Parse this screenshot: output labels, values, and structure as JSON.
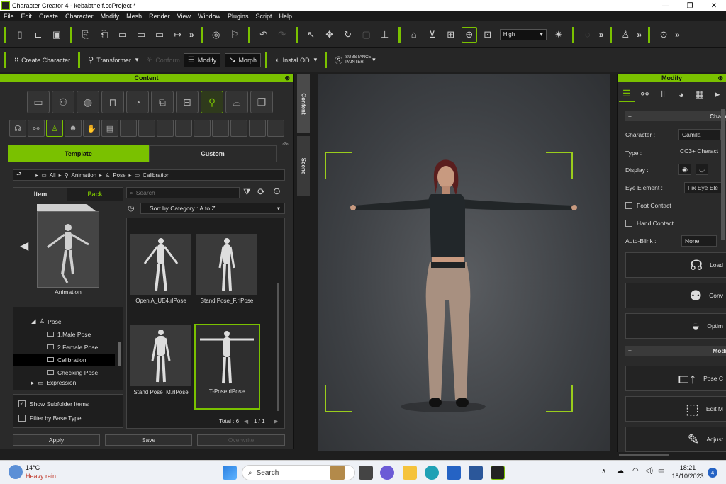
{
  "window": {
    "title": "Character Creator 4 - kebabtheif.ccProject *",
    "min": "—",
    "max": "❐",
    "close": "✕"
  },
  "menu": [
    "File",
    "Edit",
    "Create",
    "Character",
    "Modify",
    "Mesh",
    "Render",
    "View",
    "Window",
    "Plugins",
    "Script",
    "Help"
  ],
  "toolbar1": {
    "quality_value": "High"
  },
  "toolbar2": {
    "create_character": "Create Character",
    "transformer": "Transformer",
    "conform": "Conform",
    "modify": "Modify",
    "morph": "Morph",
    "instalod": "InstaLOD",
    "substance": "SUBSTANCE PAINTER"
  },
  "content_panel": {
    "title": "Content",
    "tab_template": "Template",
    "tab_custom": "Custom",
    "breadcrumb": [
      "All",
      "Animation",
      "Pose",
      "Calibration"
    ],
    "subtab_item": "Item",
    "subtab_pack": "Pack",
    "pack_label": "Animation",
    "tree": [
      {
        "label": "Pose",
        "selected": false
      },
      {
        "label": "1.Male Pose",
        "selected": false
      },
      {
        "label": "2.Female Pose",
        "selected": false
      },
      {
        "label": "Calibration",
        "selected": true
      },
      {
        "label": "Checking Pose",
        "selected": false
      },
      {
        "label": "Expression",
        "selected": false
      }
    ],
    "show_subfolder_items": "Show Subfolder Items",
    "filter_by_base_type": "Filter by Base Type",
    "search_placeholder": "Search",
    "sort_value": "Sort by Category : A to Z",
    "items": [
      {
        "label": "Open A_UE4.rlPose",
        "selected": false
      },
      {
        "label": "Stand Pose_F.rlPose",
        "selected": false
      },
      {
        "label": "Stand Pose_M.rlPose",
        "selected": false
      },
      {
        "label": "T-Pose.rlPose",
        "selected": true
      }
    ],
    "total": "Total : 6",
    "page": "1 / 1",
    "btn_apply": "Apply",
    "btn_save": "Save",
    "btn_overwrite": "Overwrite"
  },
  "side_tabs": {
    "content": "Content",
    "scene": "Scene"
  },
  "modify_panel": {
    "title": "Modify",
    "section_character": "Chara",
    "character_label": "Character :",
    "character_value": "Camila",
    "type_label": "Type :",
    "type_value": "CC3+ Charact",
    "display_label": "Display :",
    "eye_element_label": "Eye Element :",
    "eye_element_value": "Fix Eye Ele",
    "foot_contact": "Foot Contact",
    "hand_contact": "Hand Contact",
    "auto_blink_label": "Auto-Blink :",
    "auto_blink_value": "None",
    "btn_load": "Load",
    "btn_conv": "Conv",
    "btn_optim": "Optim",
    "section_modify": "Modi",
    "btn_pose": "Pose C",
    "btn_edit_mesh": "Edit M",
    "btn_adjust": "Adjust"
  },
  "taskbar": {
    "weather_temp": "14°C",
    "weather_desc": "Heavy rain",
    "search": "Search",
    "time": "18:21",
    "date": "18/10/2023",
    "notif_count": "4"
  }
}
